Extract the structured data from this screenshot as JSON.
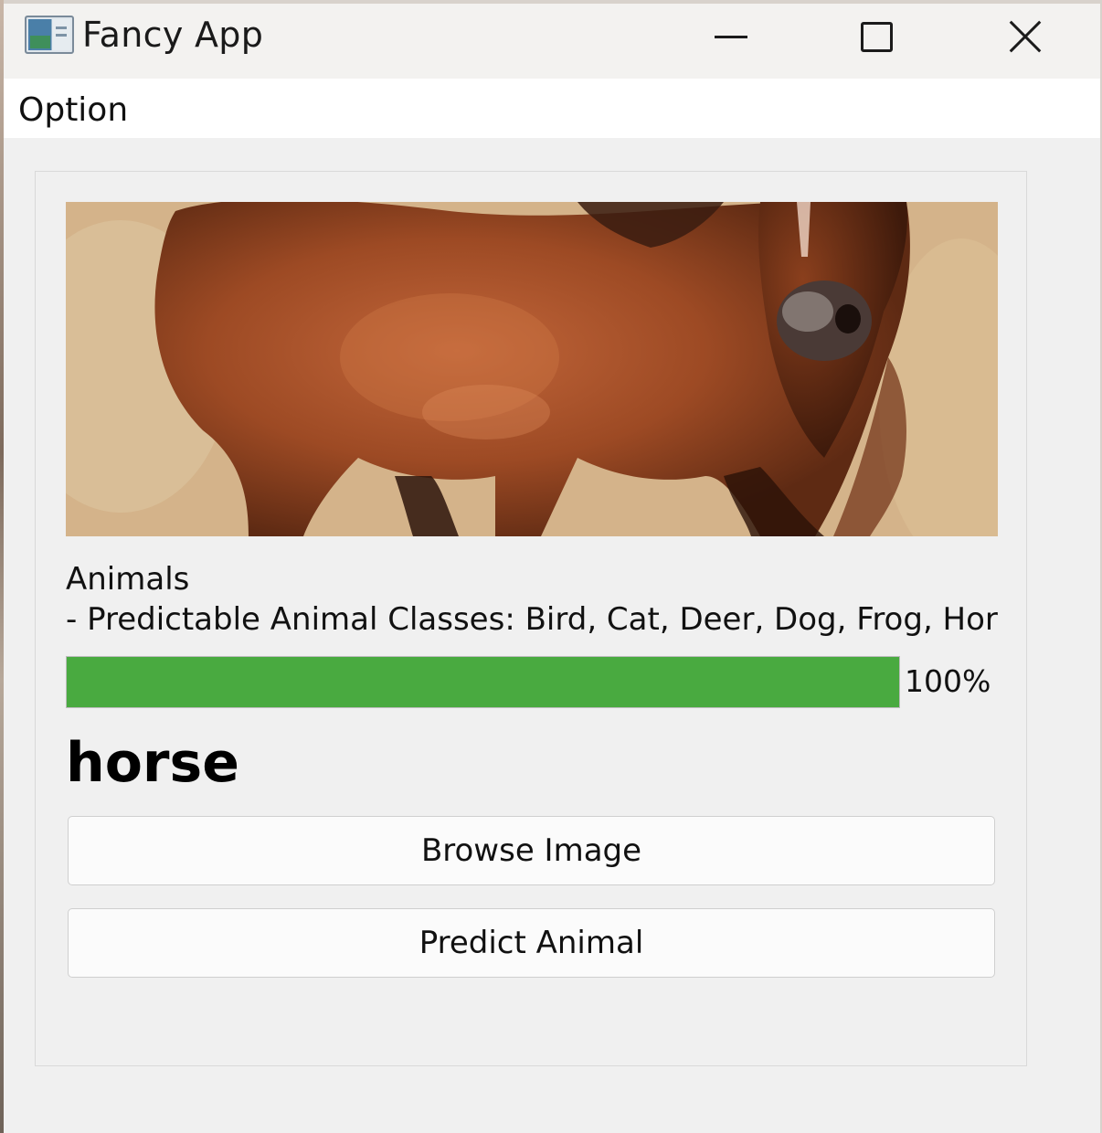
{
  "window": {
    "title": "Fancy App"
  },
  "menu": {
    "items": [
      "Option"
    ]
  },
  "content": {
    "info_line1": "Animals",
    "info_line2": "- Predictable Animal Classes: Bird, Cat, Deer, Dog, Frog, Horse",
    "progress": {
      "value": 1.0,
      "label": "100%",
      "fill_color": "#49aa40"
    },
    "prediction": "horse",
    "browse_button": "Browse Image",
    "predict_button": "Predict Animal"
  },
  "icons": {
    "app": "app-window-icon",
    "minimize": "minimize-icon",
    "maximize": "maximize-icon",
    "close": "close-icon"
  }
}
